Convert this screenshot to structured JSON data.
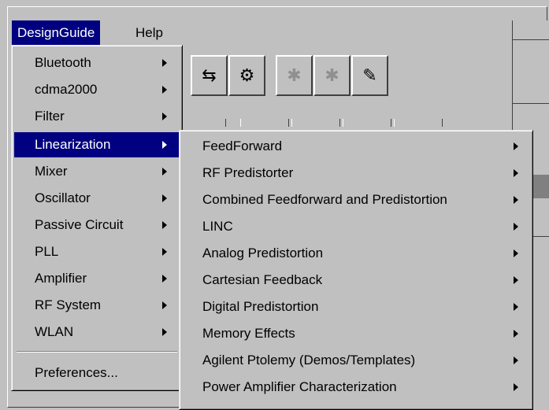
{
  "menubar": {
    "design_guide": "DesignGuide",
    "help": "Help"
  },
  "menu_design_guide": {
    "items": [
      {
        "label": "Bluetooth",
        "has_submenu": true
      },
      {
        "label": "cdma2000",
        "has_submenu": true
      },
      {
        "label": "Filter",
        "has_submenu": true
      },
      {
        "label": "Linearization",
        "has_submenu": true,
        "selected": true
      },
      {
        "label": "Mixer",
        "has_submenu": true
      },
      {
        "label": "Oscillator",
        "has_submenu": true
      },
      {
        "label": "Passive Circuit",
        "has_submenu": true
      },
      {
        "label": "PLL",
        "has_submenu": true
      },
      {
        "label": "Amplifier",
        "has_submenu": true
      },
      {
        "label": "RF System",
        "has_submenu": true
      },
      {
        "label": "WLAN",
        "has_submenu": true
      }
    ],
    "preferences": "Preferences..."
  },
  "menu_linearization": {
    "items": [
      {
        "label": "FeedForward"
      },
      {
        "label": "RF Predistorter"
      },
      {
        "label": "Combined Feedforward and Predistortion"
      },
      {
        "label": "LINC"
      },
      {
        "label": "Analog Predistortion"
      },
      {
        "label": "Cartesian Feedback"
      },
      {
        "label": "Digital Predistortion"
      },
      {
        "label": "Memory Effects"
      },
      {
        "label": "Agilent Ptolemy (Demos/Templates)"
      },
      {
        "label": "Power Amplifier Characterization"
      }
    ]
  },
  "colors": {
    "highlight": "#000080",
    "face": "#c0c0c0"
  }
}
